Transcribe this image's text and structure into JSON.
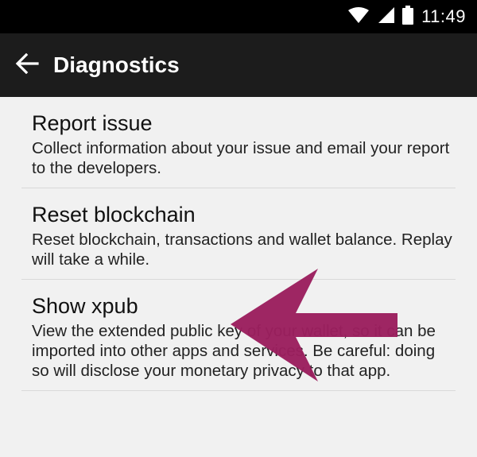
{
  "status_bar": {
    "time": "11:49",
    "icons": [
      "wifi-icon",
      "cell-signal-icon",
      "battery-icon"
    ]
  },
  "app_bar": {
    "title": "Diagnostics",
    "back_icon": "arrow-left-icon"
  },
  "items": [
    {
      "title": "Report issue",
      "summary": "Collect information about your issue and email your report to the developers."
    },
    {
      "title": "Reset blockchain",
      "summary": "Reset blockchain, transactions and wallet balance. Replay will take a while."
    },
    {
      "title": "Show xpub",
      "summary": "View the extended public key of your wallet, so it can be imported into other apps and services. Be careful: doing so will disclose your monetary privacy to that app."
    }
  ],
  "overlay": {
    "icon": "pointer-arrow-icon",
    "color": "#9b1f5e"
  }
}
